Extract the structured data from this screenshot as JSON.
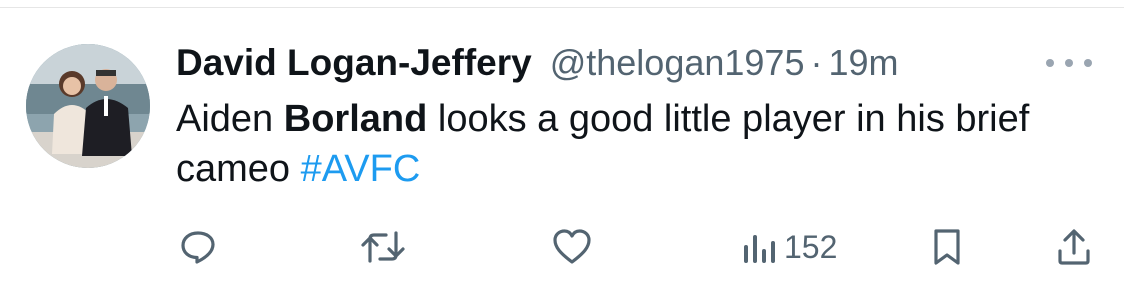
{
  "tweet": {
    "author_name": "David Logan-Jeffery",
    "handle": "@thelogan1975",
    "separator": "·",
    "time": "19m",
    "text": {
      "part1": "Aiden ",
      "bold": "Borland",
      "part2": " looks a good little player in his brief cameo ",
      "hashtag": "#AVFC"
    }
  },
  "actions": {
    "reply_icon": "reply-icon",
    "retweet_icon": "retweet-icon",
    "like_icon": "like-icon",
    "views_icon": "views-icon",
    "views_count": "152",
    "bookmark_icon": "bookmark-icon",
    "share_icon": "share-icon"
  },
  "colors": {
    "text": "#0f1419",
    "secondary": "#536471",
    "link": "#1d9bf0"
  }
}
